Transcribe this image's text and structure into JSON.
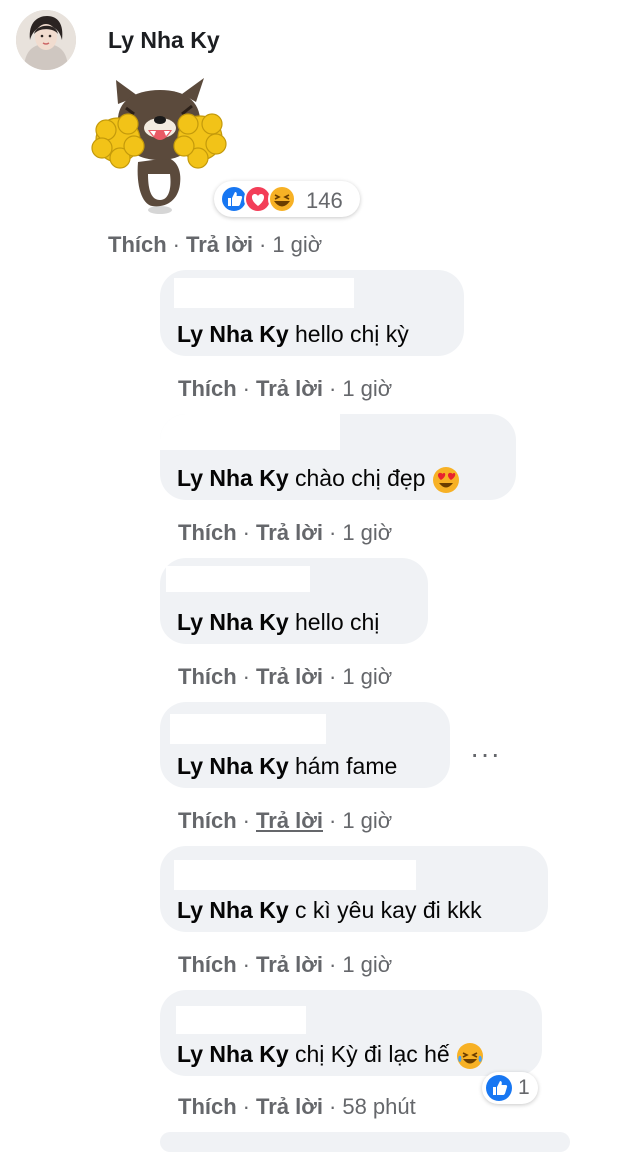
{
  "post_comment": {
    "author": "Ly Nha Ky",
    "reaction_count": "146",
    "actions": {
      "like": "Thích",
      "reply": "Trả lời",
      "time": "1 giờ"
    }
  },
  "replies": [
    {
      "mention": "Ly Nha Ky",
      "text": "hello chị kỳ",
      "like": "Thích",
      "reply": "Trả lời",
      "time": "1 giờ",
      "emoji": ""
    },
    {
      "mention": "Ly Nha Ky",
      "text": "chào chị đẹp",
      "like": "Thích",
      "reply": "Trả lời",
      "time": "1 giờ",
      "emoji": "heart-eyes-emoji"
    },
    {
      "mention": "Ly Nha Ky",
      "text": "hello chị",
      "like": "Thích",
      "reply": "Trả lời",
      "time": "1 giờ",
      "emoji": ""
    },
    {
      "mention": "Ly Nha Ky",
      "text": "hám fame",
      "like": "Thích",
      "reply": "Trả lời",
      "time": "1 giờ",
      "emoji": ""
    },
    {
      "mention": "Ly Nha Ky",
      "text": "c kì yêu kay đi kkk",
      "like": "Thích",
      "reply": "Trả lời",
      "time": "1 giờ",
      "emoji": ""
    },
    {
      "mention": "Ly Nha Ky",
      "text": "chị Kỳ đi lạc hế",
      "like": "Thích",
      "reply": "Trả lời",
      "time": "58 phút",
      "emoji": "tears-of-joy-emoji",
      "reaction_count": "1"
    }
  ],
  "more_options": "···",
  "colors": {
    "bubble": "#f0f2f5",
    "meta": "#65676b",
    "like_blue": "#1877f2",
    "love_red": "#f33e58",
    "haha_yellow": "#f7b125"
  }
}
